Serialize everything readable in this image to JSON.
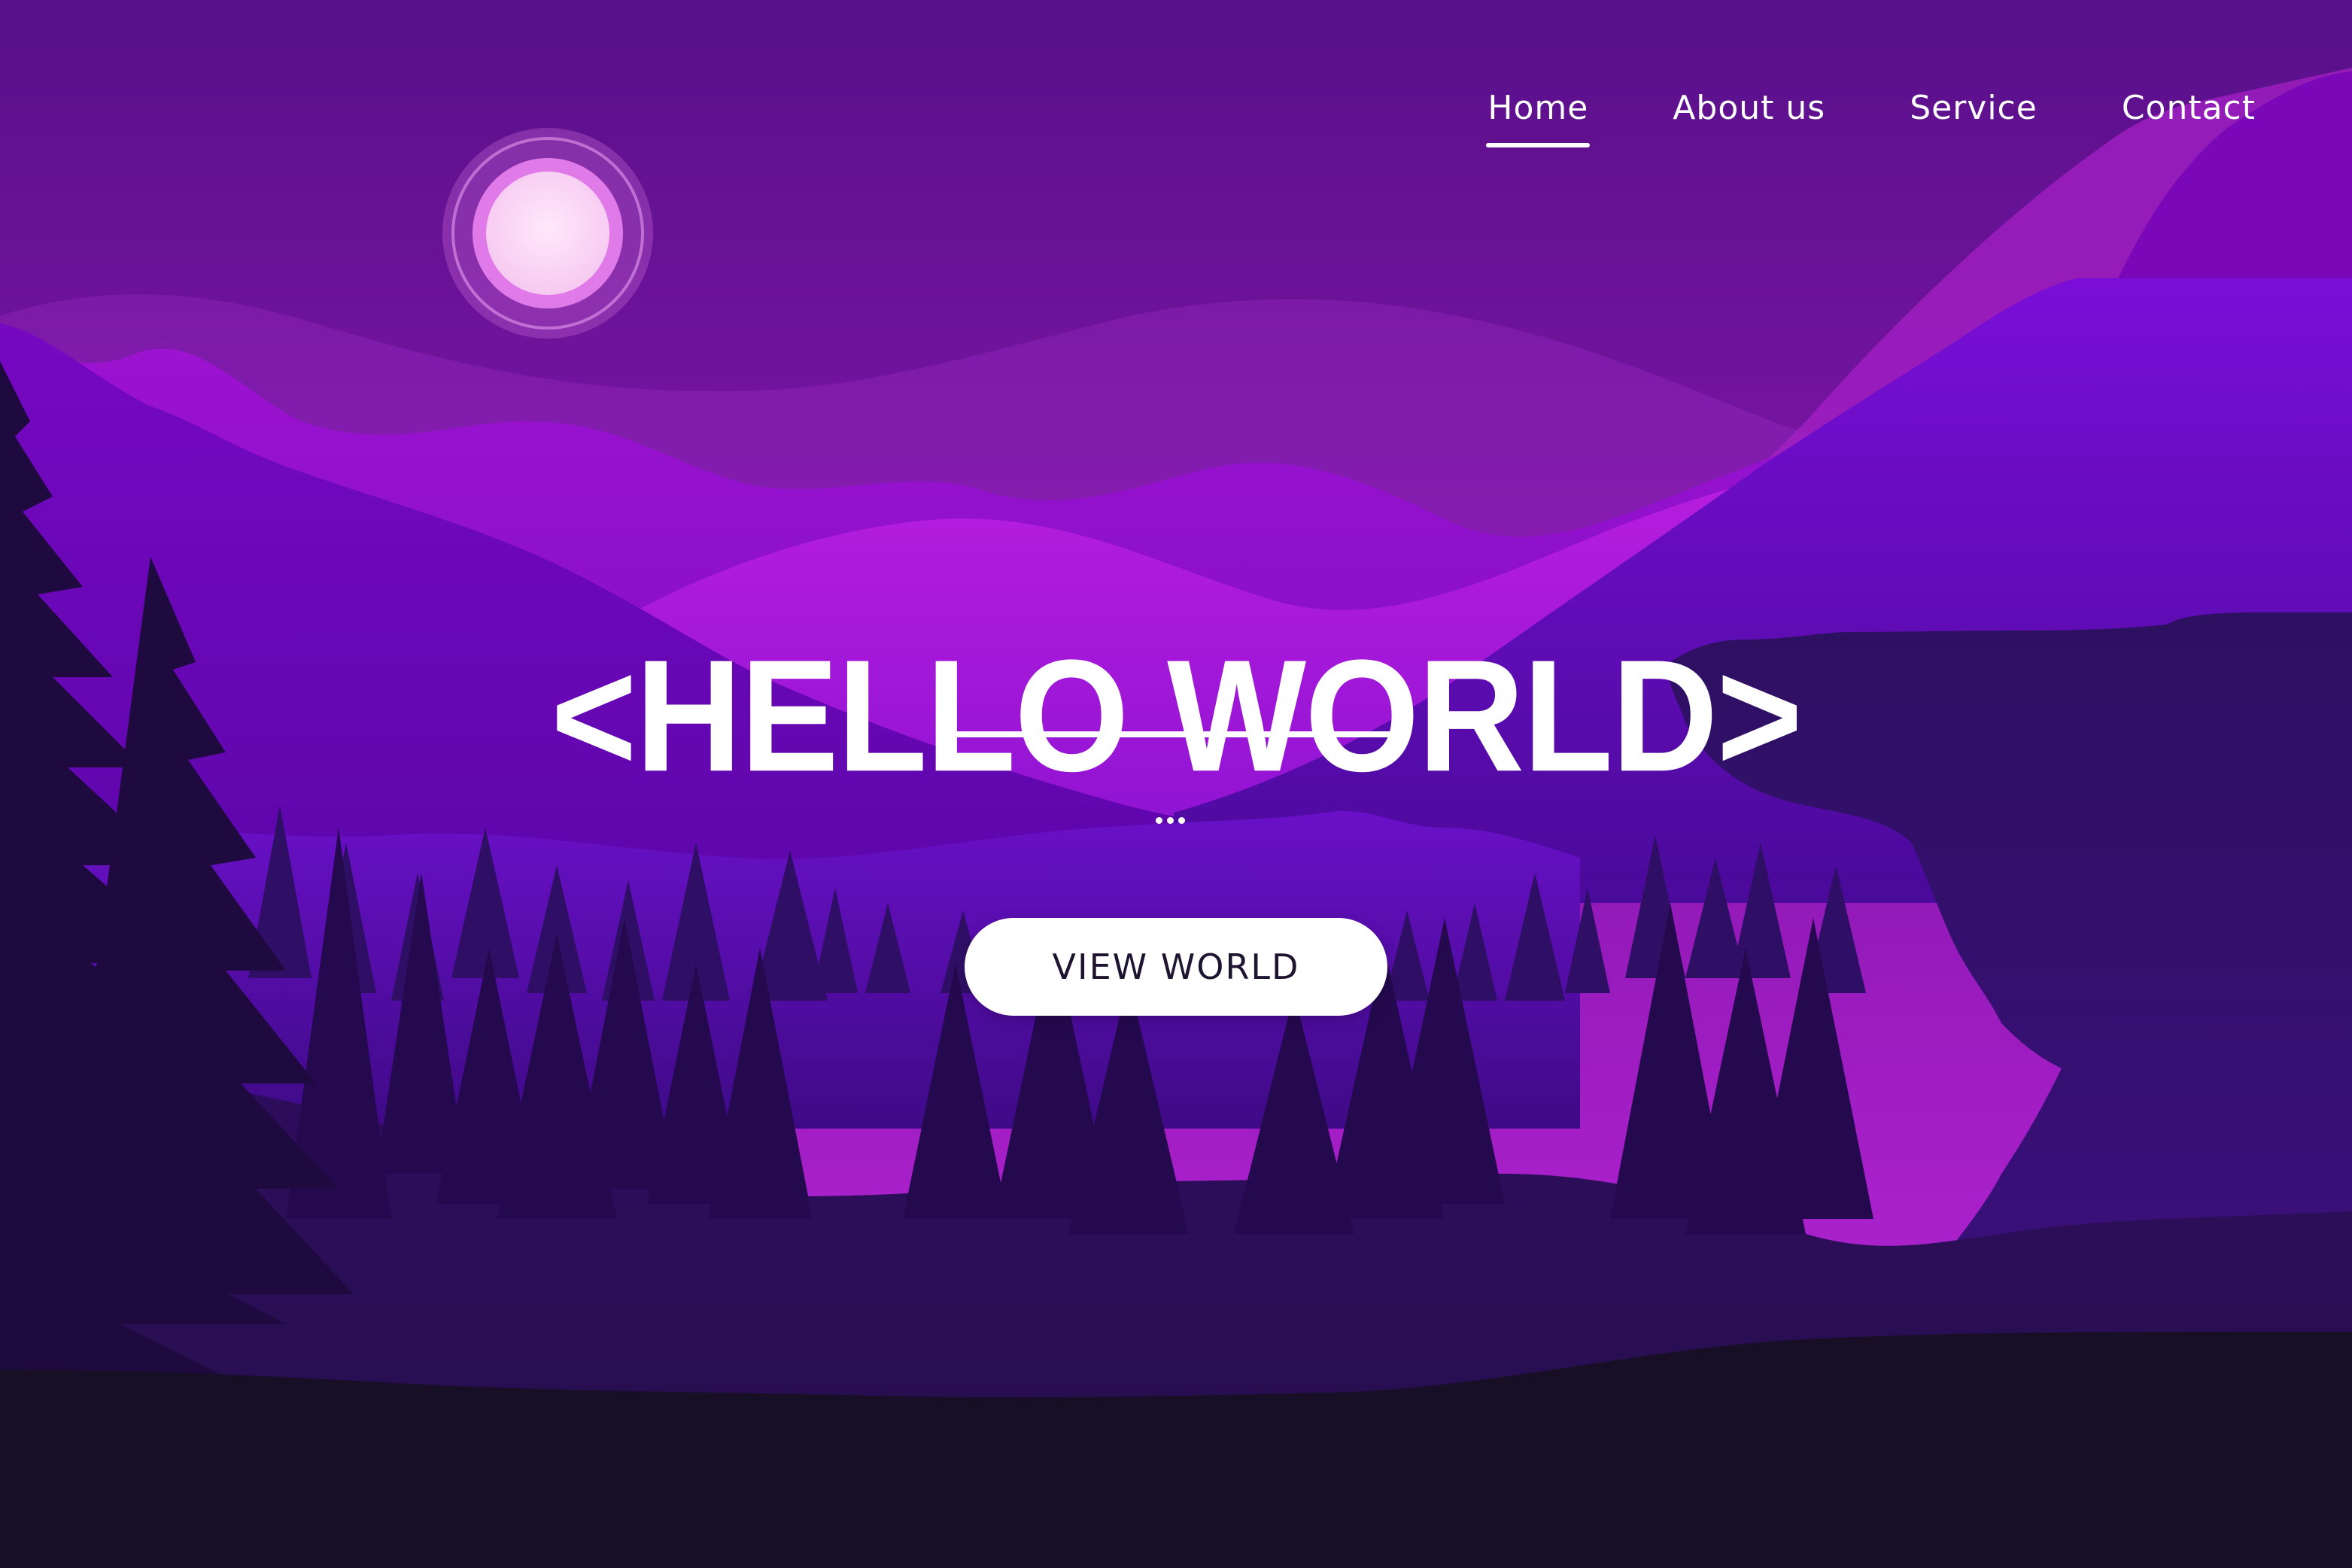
{
  "nav": {
    "items": [
      {
        "label": "Home",
        "active": true
      },
      {
        "label": "About us",
        "active": false
      },
      {
        "label": "Service",
        "active": false
      },
      {
        "label": "Contact",
        "active": false
      }
    ]
  },
  "hero": {
    "title": "<HELLO WORLD>",
    "cta_label": "VIEW WORLD"
  },
  "colors": {
    "sky_top": "#5a0f8c",
    "sky_bottom": "#9a22c9",
    "accent": "#b125e0",
    "moon": "#fbd6f6",
    "ground": "#160f24"
  }
}
